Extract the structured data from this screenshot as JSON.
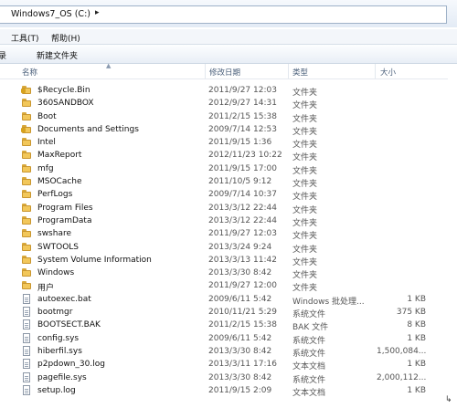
{
  "address": {
    "path": "Windows7_OS (C:)",
    "chevron": "▸"
  },
  "menu": {
    "items": [
      "工具(T)",
      "帮助(H)"
    ]
  },
  "toolbar": {
    "left_fragment": "录",
    "new_folder": "新建文件夹"
  },
  "columns": {
    "name": "名称",
    "date": "修改日期",
    "type": "类型",
    "size": "大小"
  },
  "rows": [
    {
      "icon": "folder-lock-icon",
      "name": "$Recycle.Bin",
      "date": "2011/9/27 12:03",
      "type": "文件夹",
      "size": ""
    },
    {
      "icon": "folder-icon",
      "name": "360SANDBOX",
      "date": "2012/9/27 14:31",
      "type": "文件夹",
      "size": ""
    },
    {
      "icon": "folder-icon",
      "name": "Boot",
      "date": "2011/2/15 15:38",
      "type": "文件夹",
      "size": ""
    },
    {
      "icon": "folder-lock-icon",
      "name": "Documents and Settings",
      "date": "2009/7/14 12:53",
      "type": "文件夹",
      "size": ""
    },
    {
      "icon": "folder-icon",
      "name": "Intel",
      "date": "2011/9/15 1:36",
      "type": "文件夹",
      "size": ""
    },
    {
      "icon": "folder-icon",
      "name": "MaxReport",
      "date": "2012/11/23 10:22",
      "type": "文件夹",
      "size": ""
    },
    {
      "icon": "folder-icon",
      "name": "mfg",
      "date": "2011/9/15 17:00",
      "type": "文件夹",
      "size": ""
    },
    {
      "icon": "folder-icon",
      "name": "MSOCache",
      "date": "2011/10/5 9:12",
      "type": "文件夹",
      "size": ""
    },
    {
      "icon": "folder-icon",
      "name": "PerfLogs",
      "date": "2009/7/14 10:37",
      "type": "文件夹",
      "size": ""
    },
    {
      "icon": "folder-icon",
      "name": "Program Files",
      "date": "2013/3/12 22:44",
      "type": "文件夹",
      "size": ""
    },
    {
      "icon": "folder-icon",
      "name": "ProgramData",
      "date": "2013/3/12 22:44",
      "type": "文件夹",
      "size": ""
    },
    {
      "icon": "folder-icon",
      "name": "swshare",
      "date": "2011/9/27 12:03",
      "type": "文件夹",
      "size": ""
    },
    {
      "icon": "folder-icon",
      "name": "SWTOOLS",
      "date": "2013/3/24 9:24",
      "type": "文件夹",
      "size": ""
    },
    {
      "icon": "folder-icon",
      "name": "System Volume Information",
      "date": "2013/3/13 11:42",
      "type": "文件夹",
      "size": ""
    },
    {
      "icon": "folder-icon",
      "name": "Windows",
      "date": "2013/3/30 8:42",
      "type": "文件夹",
      "size": ""
    },
    {
      "icon": "folder-icon",
      "name": "用户",
      "date": "2011/9/27 12:00",
      "type": "文件夹",
      "size": ""
    },
    {
      "icon": "file-icon",
      "name": "autoexec.bat",
      "date": "2009/6/11 5:42",
      "type": "Windows 批处理...",
      "size": "1 KB"
    },
    {
      "icon": "file-icon",
      "name": "bootmgr",
      "date": "2010/11/21 5:29",
      "type": "系统文件",
      "size": "375 KB"
    },
    {
      "icon": "file-icon",
      "name": "BOOTSECT.BAK",
      "date": "2011/2/15 15:38",
      "type": "BAK 文件",
      "size": "8 KB"
    },
    {
      "icon": "file-icon",
      "name": "config.sys",
      "date": "2009/6/11 5:42",
      "type": "系统文件",
      "size": "1 KB"
    },
    {
      "icon": "file-icon",
      "name": "hiberfil.sys",
      "date": "2013/3/30 8:42",
      "type": "系统文件",
      "size": "1,500,084..."
    },
    {
      "icon": "file-icon",
      "name": "p2pdown_30.log",
      "date": "2013/3/11 17:16",
      "type": "文本文档",
      "size": "1 KB"
    },
    {
      "icon": "file-icon",
      "name": "pagefile.sys",
      "date": "2013/3/30 8:42",
      "type": "系统文件",
      "size": "2,000,112..."
    },
    {
      "icon": "file-icon",
      "name": "setup.log",
      "date": "2011/9/15 2:09",
      "type": "文本文档",
      "size": "1 KB"
    }
  ]
}
